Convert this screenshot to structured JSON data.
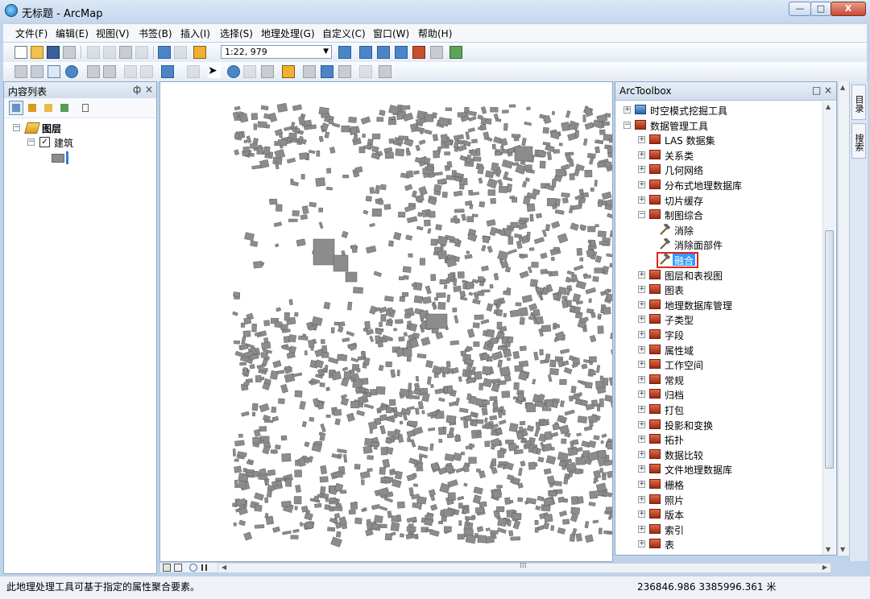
{
  "window": {
    "title": "无标题 - ArcMap",
    "controls": [
      "—",
      "□",
      "X"
    ]
  },
  "menubar": {
    "items": [
      "文件(F)",
      "编辑(E)",
      "视图(V)",
      "书签(B)",
      "插入(I)",
      "选择(S)",
      "地理处理(G)",
      "自定义(C)",
      "窗口(W)",
      "帮助(H)"
    ]
  },
  "toolbar": {
    "scale": "1:22, 979"
  },
  "toc": {
    "title": "内容列表",
    "pin": "ф",
    "close": "×",
    "group_label": "图层",
    "layer_label": "建筑",
    "layer_checked": "✓"
  },
  "toolbox": {
    "title": "ArcToolbox",
    "items": [
      {
        "label": "时空模式挖掘工具",
        "level": 0,
        "kind": "toolbox",
        "expander": "+"
      },
      {
        "label": "数据管理工具",
        "level": 0,
        "kind": "toolbox",
        "expander": "−"
      },
      {
        "label": "LAS 数据集",
        "level": 1,
        "kind": "toolset",
        "expander": "+"
      },
      {
        "label": "关系类",
        "level": 1,
        "kind": "toolset",
        "expander": "+"
      },
      {
        "label": "几何网络",
        "level": 1,
        "kind": "toolset",
        "expander": "+"
      },
      {
        "label": "分布式地理数据库",
        "level": 1,
        "kind": "toolset",
        "expander": "+"
      },
      {
        "label": "切片缓存",
        "level": 1,
        "kind": "toolset",
        "expander": "+"
      },
      {
        "label": "制图综合",
        "level": 1,
        "kind": "toolset",
        "expander": "−"
      },
      {
        "label": "消除",
        "level": 2,
        "kind": "tool",
        "expander": ""
      },
      {
        "label": "消除面部件",
        "level": 2,
        "kind": "tool",
        "expander": ""
      },
      {
        "label": "融合",
        "level": 2,
        "kind": "tool",
        "expander": "",
        "selected": true
      },
      {
        "label": "图层和表视图",
        "level": 1,
        "kind": "toolset",
        "expander": "+"
      },
      {
        "label": "图表",
        "level": 1,
        "kind": "toolset",
        "expander": "+"
      },
      {
        "label": "地理数据库管理",
        "level": 1,
        "kind": "toolset",
        "expander": "+"
      },
      {
        "label": "子类型",
        "level": 1,
        "kind": "toolset",
        "expander": "+"
      },
      {
        "label": "字段",
        "level": 1,
        "kind": "toolset",
        "expander": "+"
      },
      {
        "label": "属性域",
        "level": 1,
        "kind": "toolset",
        "expander": "+"
      },
      {
        "label": "工作空间",
        "level": 1,
        "kind": "toolset",
        "expander": "+"
      },
      {
        "label": "常规",
        "level": 1,
        "kind": "toolset",
        "expander": "+"
      },
      {
        "label": "归档",
        "level": 1,
        "kind": "toolset",
        "expander": "+"
      },
      {
        "label": "打包",
        "level": 1,
        "kind": "toolset",
        "expander": "+"
      },
      {
        "label": "投影和变换",
        "level": 1,
        "kind": "toolset",
        "expander": "+"
      },
      {
        "label": "拓扑",
        "level": 1,
        "kind": "toolset",
        "expander": "+"
      },
      {
        "label": "数据比较",
        "level": 1,
        "kind": "toolset",
        "expander": "+"
      },
      {
        "label": "文件地理数据库",
        "level": 1,
        "kind": "toolset",
        "expander": "+"
      },
      {
        "label": "栅格",
        "level": 1,
        "kind": "toolset",
        "expander": "+"
      },
      {
        "label": "照片",
        "level": 1,
        "kind": "toolset",
        "expander": "+"
      },
      {
        "label": "版本",
        "level": 1,
        "kind": "toolset",
        "expander": "+"
      },
      {
        "label": "索引",
        "level": 1,
        "kind": "toolset",
        "expander": "+"
      },
      {
        "label": "表",
        "level": 1,
        "kind": "toolset",
        "expander": "+"
      }
    ]
  },
  "right_dock": {
    "tabs": [
      "目录",
      "搜索"
    ]
  },
  "status": {
    "message": "此地理处理工具可基于指定的属性聚合要素。",
    "coordinates": "236846.986  3385996.361 米"
  },
  "colors": {
    "building_fill": "#8c8c8c",
    "selection": "#3399ff",
    "highlight_border": "#e0261c"
  }
}
